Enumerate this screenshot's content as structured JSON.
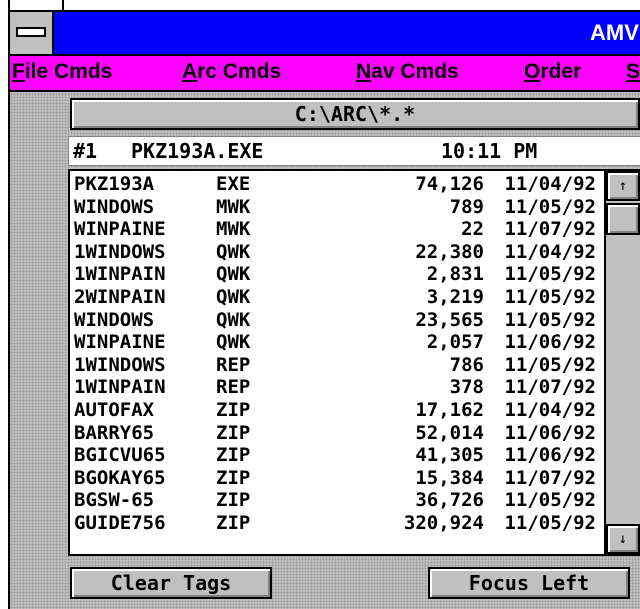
{
  "window": {
    "title": "AMV"
  },
  "menu": [
    {
      "accel": "F",
      "rest": "ile Cmds"
    },
    {
      "accel": "A",
      "rest": "rc Cmds"
    },
    {
      "accel": "N",
      "rest": "av Cmds"
    },
    {
      "accel": "O",
      "rest": "rder"
    },
    {
      "accel": "S",
      "rest": ""
    }
  ],
  "path": "C:\\ARC\\*.*",
  "info": {
    "index": "#1",
    "filename": "PKZ193A.EXE",
    "time": "10:11 PM"
  },
  "files": [
    {
      "name": "PKZ193A",
      "ext": "EXE",
      "size": "74,126",
      "date": "11/04/92"
    },
    {
      "name": "WINDOWS",
      "ext": "MWK",
      "size": "789",
      "date": "11/05/92"
    },
    {
      "name": "WINPAINE",
      "ext": "MWK",
      "size": "22",
      "date": "11/07/92"
    },
    {
      "name": "1WINDOWS",
      "ext": "QWK",
      "size": "22,380",
      "date": "11/04/92"
    },
    {
      "name": "1WINPAIN",
      "ext": "QWK",
      "size": "2,831",
      "date": "11/05/92"
    },
    {
      "name": "2WINPAIN",
      "ext": "QWK",
      "size": "3,219",
      "date": "11/05/92"
    },
    {
      "name": "WINDOWS",
      "ext": "QWK",
      "size": "23,565",
      "date": "11/05/92"
    },
    {
      "name": "WINPAINE",
      "ext": "QWK",
      "size": "2,057",
      "date": "11/06/92"
    },
    {
      "name": "1WINDOWS",
      "ext": "REP",
      "size": "786",
      "date": "11/05/92"
    },
    {
      "name": "1WINPAIN",
      "ext": "REP",
      "size": "378",
      "date": "11/07/92"
    },
    {
      "name": "AUTOFAX",
      "ext": "ZIP",
      "size": "17,162",
      "date": "11/04/92"
    },
    {
      "name": "BARRY65",
      "ext": "ZIP",
      "size": "52,014",
      "date": "11/06/92"
    },
    {
      "name": "BGICVU65",
      "ext": "ZIP",
      "size": "41,305",
      "date": "11/06/92"
    },
    {
      "name": "BGOKAY65",
      "ext": "ZIP",
      "size": "15,384",
      "date": "11/07/92"
    },
    {
      "name": "BGSW-65",
      "ext": "ZIP",
      "size": "36,726",
      "date": "11/05/92"
    },
    {
      "name": "GUIDE756",
      "ext": "ZIP",
      "size": "320,924",
      "date": "11/05/92"
    }
  ],
  "scrollbar": {
    "up_icon": "arrow-up-icon",
    "down_icon": "arrow-down-icon",
    "up_glyph": "↑",
    "down_glyph": "↓"
  },
  "buttons": {
    "clear_tags": "Clear Tags",
    "focus_left": "Focus Left"
  },
  "colors": {
    "titlebar": "#0000ff",
    "menubar": "#ff00ff",
    "face": "#c0c0c0"
  }
}
